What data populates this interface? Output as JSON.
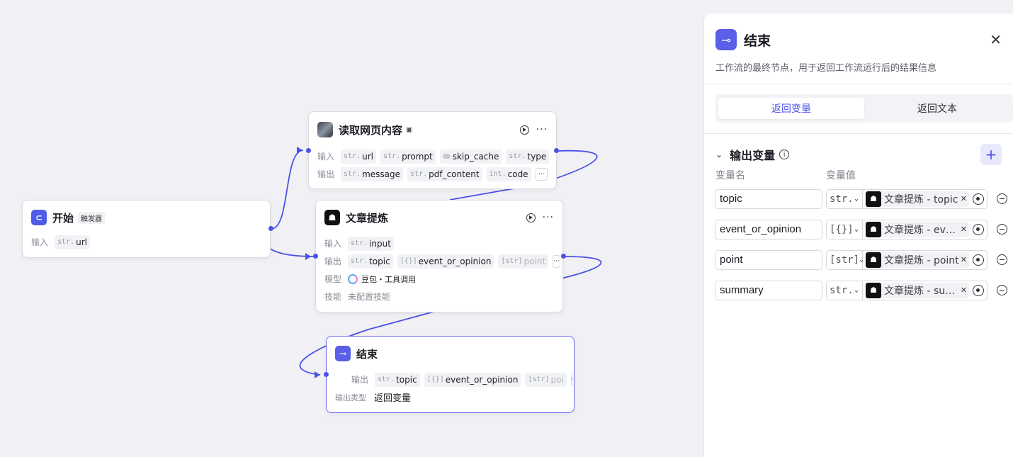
{
  "colors": {
    "accent": "#4b52e6",
    "canvas_bg": "#f0f0f5",
    "edge": "#4b52e6"
  },
  "canvas": {
    "node_read": {
      "title": "读取网页内容",
      "badge_icon": "plugin-icon",
      "input_label": "输入",
      "output_label": "输出",
      "inputs": [
        {
          "type": "str.",
          "name": "url"
        },
        {
          "type": "str.",
          "name": "prompt"
        },
        {
          "type": "toggle",
          "name": "skip_cache"
        },
        {
          "type": "str.",
          "name": "type"
        }
      ],
      "outputs": [
        {
          "type": "str.",
          "name": "message"
        },
        {
          "type": "str.",
          "name": "pdf_content"
        },
        {
          "type": "int.",
          "name": "code"
        }
      ],
      "more": "···"
    },
    "node_start": {
      "title": "开始",
      "badge": "触发器",
      "input_label": "输入",
      "inputs": [
        {
          "type": "str.",
          "name": "url"
        }
      ]
    },
    "node_article": {
      "title": "文章提炼",
      "input_label": "输入",
      "output_label": "输出",
      "model_label": "模型",
      "skill_label": "技能",
      "inputs": [
        {
          "type": "str.",
          "name": "input"
        }
      ],
      "outputs": [
        {
          "type": "str.",
          "name": "topic"
        },
        {
          "type": "[{}]",
          "name": "event_or_opinion"
        },
        {
          "type": "[str]",
          "name": "point"
        }
      ],
      "model": "豆包・工具调用",
      "skill": "未配置技能",
      "more": "···"
    },
    "node_end": {
      "title": "结束",
      "output_label": "输出",
      "output_type_label": "输出类型",
      "outputs": [
        {
          "type": "str.",
          "name": "topic"
        },
        {
          "type": "[{}]",
          "name": "event_or_opinion"
        },
        {
          "type": "[str]",
          "name": "poi"
        }
      ],
      "output_type": "返回变量",
      "more": "···"
    }
  },
  "panel": {
    "title": "结束",
    "description": "工作流的最终节点，用于返回工作流运行后的结果信息",
    "tabs": [
      {
        "label": "返回变量",
        "active": true
      },
      {
        "label": "返回文本",
        "active": false
      }
    ],
    "section_title": "输出变量",
    "col_name": "变量名",
    "col_value": "变量值",
    "variables": [
      {
        "name": "topic",
        "type": "str.",
        "ref": "文章提炼 - topic"
      },
      {
        "name": "event_or_opinion",
        "type": "[{}]",
        "ref": "文章提炼 - event_or_opinion"
      },
      {
        "name": "point",
        "type": "[str]",
        "ref": "文章提炼 - point"
      },
      {
        "name": "summary",
        "type": "str.",
        "ref": "文章提炼 - summary"
      }
    ]
  }
}
